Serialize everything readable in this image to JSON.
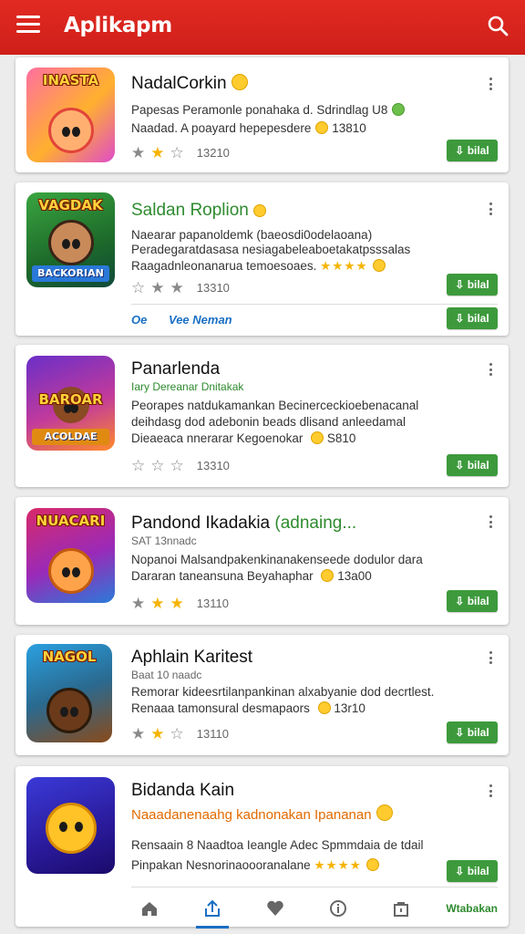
{
  "app_bar": {
    "title": "Aplikapm",
    "brand_color": "#d6241d"
  },
  "apps": [
    {
      "name": "NadalCorkin",
      "subtitle": "",
      "desc1": "Papesas Peramonle ponahaka d. Sdrindlag U8",
      "desc2": "Naadad. A poayard hepepesdere",
      "desc2_tail": "13810",
      "rating_text": "13210",
      "action": "bilal",
      "thumb_label": "INASTA"
    },
    {
      "name": "Saldan Roplion",
      "subtitle": "",
      "desc1": "Naearar papanoldemk (baeosdi0odelaoana)",
      "desc2": "Peradegaratdasasa nesiagabeleaboetakatpsssalas",
      "desc3": "Raagadnleonanarua temoesoaes.",
      "rating_text": "13310",
      "action": "bilal",
      "link_left": "Oe",
      "link_right": "Vee Neman",
      "action2": "bilal",
      "thumb_label": "VAGDAK",
      "thumb_ribbon": "BACKORIAN"
    },
    {
      "name": "Panarlenda",
      "subtitle": "Iary Dereanar Dnitakak",
      "desc1": "Peorapes natdukamankan Becinerceckioebenacanal",
      "desc2": "deihdasg dod adebonin beads dlisand anleedamal",
      "desc3": "Dieaeaca nnerarar Kegoenokar",
      "desc3_tail": "S810",
      "rating_text": "13310",
      "action": "bilal",
      "thumb_label": "BAROAR",
      "thumb_ribbon": "ACOLDAE"
    },
    {
      "name": "Pandond Ikadakia",
      "name_tail": "(adnaing...",
      "subtitle": "SAT 13nnadc",
      "desc1": "Nopanoi Malsandpakenkinanakenseede dodulor dara",
      "desc2": "Dararan taneansuna Beyahaphar",
      "desc2_tail": "13a00",
      "rating_text": "13110",
      "action": "bilal",
      "thumb_label": "NUACARI"
    },
    {
      "name": "Aphlain Karitest",
      "subtitle": "Baat 10 naadc",
      "desc1": "Remorar kideesrtilanpankinan alxabyanie dod decrtlest.",
      "desc2": "Renaaa tamonsural desmapaors",
      "desc2_tail": "13r10",
      "rating_text": "13110",
      "action": "bilal",
      "thumb_label": "NAGOL"
    },
    {
      "name": "Bidanda Kain",
      "subtitle": "Naaadanenaahg kadnonakan Ipananan",
      "desc1": "Rensaain 8 Naadtoa Ieangle Adec Spmmdaia de tdail",
      "desc2": "Pinpakan Nesnorinaoooranalane",
      "action": "bilal",
      "thumb_label": ""
    }
  ],
  "bottom_nav": {
    "items": [
      "home",
      "share",
      "heart",
      "info",
      "bag"
    ],
    "active": "share",
    "text": "Wtabakan"
  }
}
